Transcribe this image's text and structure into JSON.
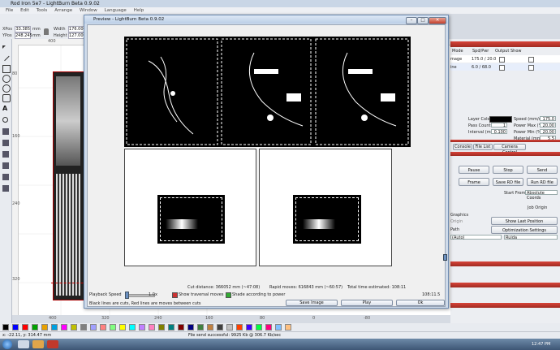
{
  "app": {
    "title": "Rod Iron 5e7 - LightBurn Beta 0.9.02",
    "menu": [
      "File",
      "Edit",
      "Tools",
      "Arrange",
      "Window",
      "Language",
      "Help"
    ]
  },
  "numeric": {
    "xpos_label": "XPos",
    "xpos_value": "33.385",
    "ypos_label": "YPos",
    "ypos_value": "248.245",
    "unit": "mm",
    "width_label": "Width",
    "width_value": "176.000",
    "height_label": "Height",
    "height_value": "127.000"
  },
  "rulers": {
    "top": [
      "400"
    ],
    "left": [
      "80",
      "160",
      "240",
      "320"
    ],
    "bottom": [
      "400",
      "320",
      "240",
      "160",
      "80",
      "0",
      "-80"
    ]
  },
  "right_panel": {
    "cuts_headers": [
      "Mode",
      "Spd/Pwr",
      "Output",
      "Show"
    ],
    "rows": [
      {
        "mode": "mage",
        "spd_pwr": "175.0 / 20.0"
      },
      {
        "mode": "ine",
        "spd_pwr": "6.0 / 68.0"
      }
    ],
    "layer_color_label": "Layer Color",
    "pass_count_label": "Pass Count",
    "pass_count_value": "1",
    "interval_label": "Interval (mm)",
    "interval_value": "0.100",
    "speed_label": "Speed (mm/s)",
    "speed_value": "175.0",
    "power_max_label": "Power Max (%)",
    "power_max_value": "20.00",
    "power_min_label": "Power Min (%)",
    "power_min_value": "20.00",
    "material_label": "Material (mm)",
    "material_value": "5.5",
    "tabs": [
      "Console",
      "File List",
      "Camera Control"
    ],
    "pause_label": "Pause",
    "stop_label": "Stop",
    "send_label": "Send",
    "frame_label": "Frame",
    "save_rd_label": "Save RD file",
    "run_rd_label": "Run RD file",
    "start_from_label": "Start From:",
    "start_from_value": "Absolute Coords",
    "job_origin_label": "Job Origin",
    "graphics_label": "Graphics",
    "origin_label": "Origin",
    "show_last_label": "Show Last Position",
    "path_label": "Path",
    "optimization_label": "Optimization Settings",
    "device_value": "(Auto)",
    "device2_value": "Ruida"
  },
  "preview": {
    "title": "Preview - LightBurn Beta 0.9.02",
    "cut_distance": "Cut distance: 366052 mm (~47:08)",
    "rapid_moves": "Rapid moves: 616843 mm (~60:57)",
    "total_time": "Total time estimated: 108:11",
    "playback_label": "Playback Speed",
    "playback_value": "1.0x",
    "show_traversal": "Show traversal moves",
    "shade_power": "Shade according to power",
    "time_readout": "108:11.5",
    "legend_note": "Black lines are cuts, Red lines are moves between cuts",
    "save_image": "Save Image",
    "play": "Play",
    "ok": "Ok"
  },
  "status": {
    "coords": "x: -22.11, y: 314.47 mm",
    "message": "File send successful: 9925 Kb @ 306.7 Kb/sec"
  },
  "taskbar": {
    "clock": "12:47 PM"
  },
  "palette_colors": [
    "#000000",
    "#0000ff",
    "#ff0000",
    "#00a000",
    "#e8a000",
    "#00a0e0",
    "#ff00ff",
    "#c0c000",
    "#808080",
    "#a0a0ff",
    "#ff8080",
    "#80ff80",
    "#ffff00",
    "#00ffff",
    "#c080ff",
    "#ff80c0",
    "#808000",
    "#008080",
    "#800000",
    "#000080",
    "#408040",
    "#c08040",
    "#404040",
    "#c0c0c0",
    "#ff4000",
    "#4000ff",
    "#00ff40",
    "#ff0080",
    "#80c0ff",
    "#ffc080"
  ]
}
